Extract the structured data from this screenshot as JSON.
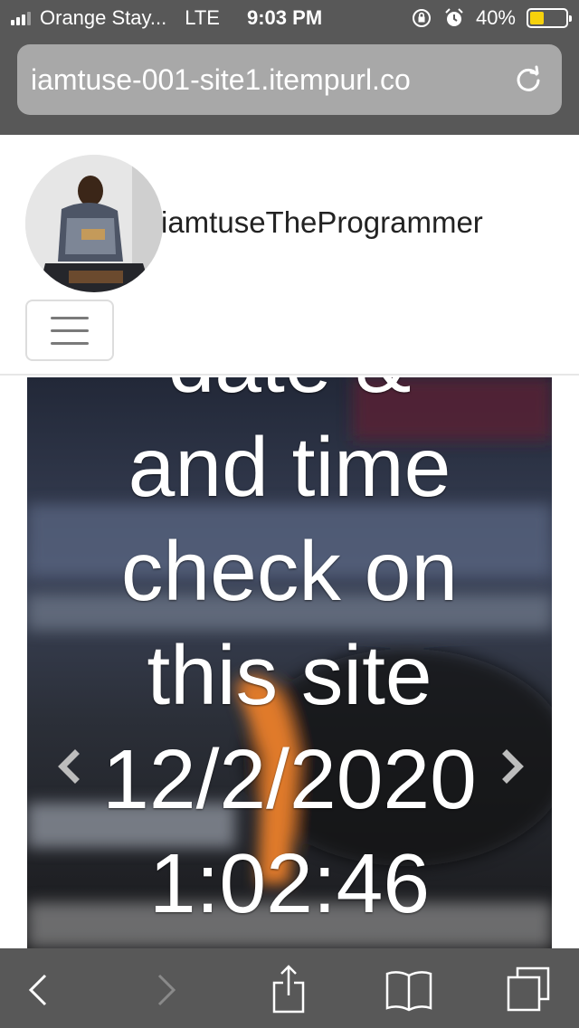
{
  "status_bar": {
    "carrier": "Orange Stay...",
    "network": "LTE",
    "time": "9:03 PM",
    "battery_percent_label": "40%",
    "battery_level": 0.4,
    "icons": [
      "signal-icon",
      "lock-rotation-icon",
      "alarm-icon",
      "battery-icon"
    ]
  },
  "browser": {
    "url": "iamtuse-001-site1.itempurl.co",
    "reload_icon": "reload-icon"
  },
  "navbar": {
    "brand": "iamtuseTheProgrammer",
    "toggler_icon": "hamburger-icon"
  },
  "carousel": {
    "caption_lines": [
      "date &",
      "and time",
      "check on",
      "this site",
      "12/2/2020",
      "1:02:46"
    ],
    "prev_icon": "chevron-left-icon",
    "next_icon": "chevron-right-icon"
  },
  "toolbar": {
    "buttons": [
      "back-icon",
      "forward-icon",
      "share-icon",
      "bookmarks-icon",
      "tabs-icon"
    ]
  },
  "colors": {
    "chrome": "#585858",
    "url_field": "#a8a8a8",
    "battery_fill": "#f5d10c"
  }
}
